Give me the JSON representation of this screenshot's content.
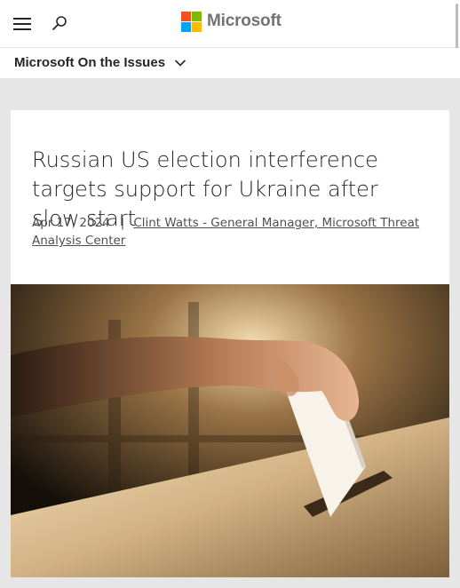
{
  "header": {
    "brand": "Microsoft",
    "menu_icon": "hamburger-menu-icon",
    "search_icon": "search-icon",
    "logo_colors": [
      "#f25022",
      "#7fba00",
      "#00a4ef",
      "#ffb900"
    ]
  },
  "subnav": {
    "label": "Microsoft On the Issues",
    "icon": "chevron-down-icon"
  },
  "article": {
    "title": "Russian US election interference targets support for Ukraine after slow start",
    "date": "Apr 17, 2024",
    "separator": "|",
    "author": "Clint Watts - General Manager, Microsoft Threat Analysis Center"
  },
  "hero": {
    "subject": "hand-placing-ballot-in-box"
  }
}
